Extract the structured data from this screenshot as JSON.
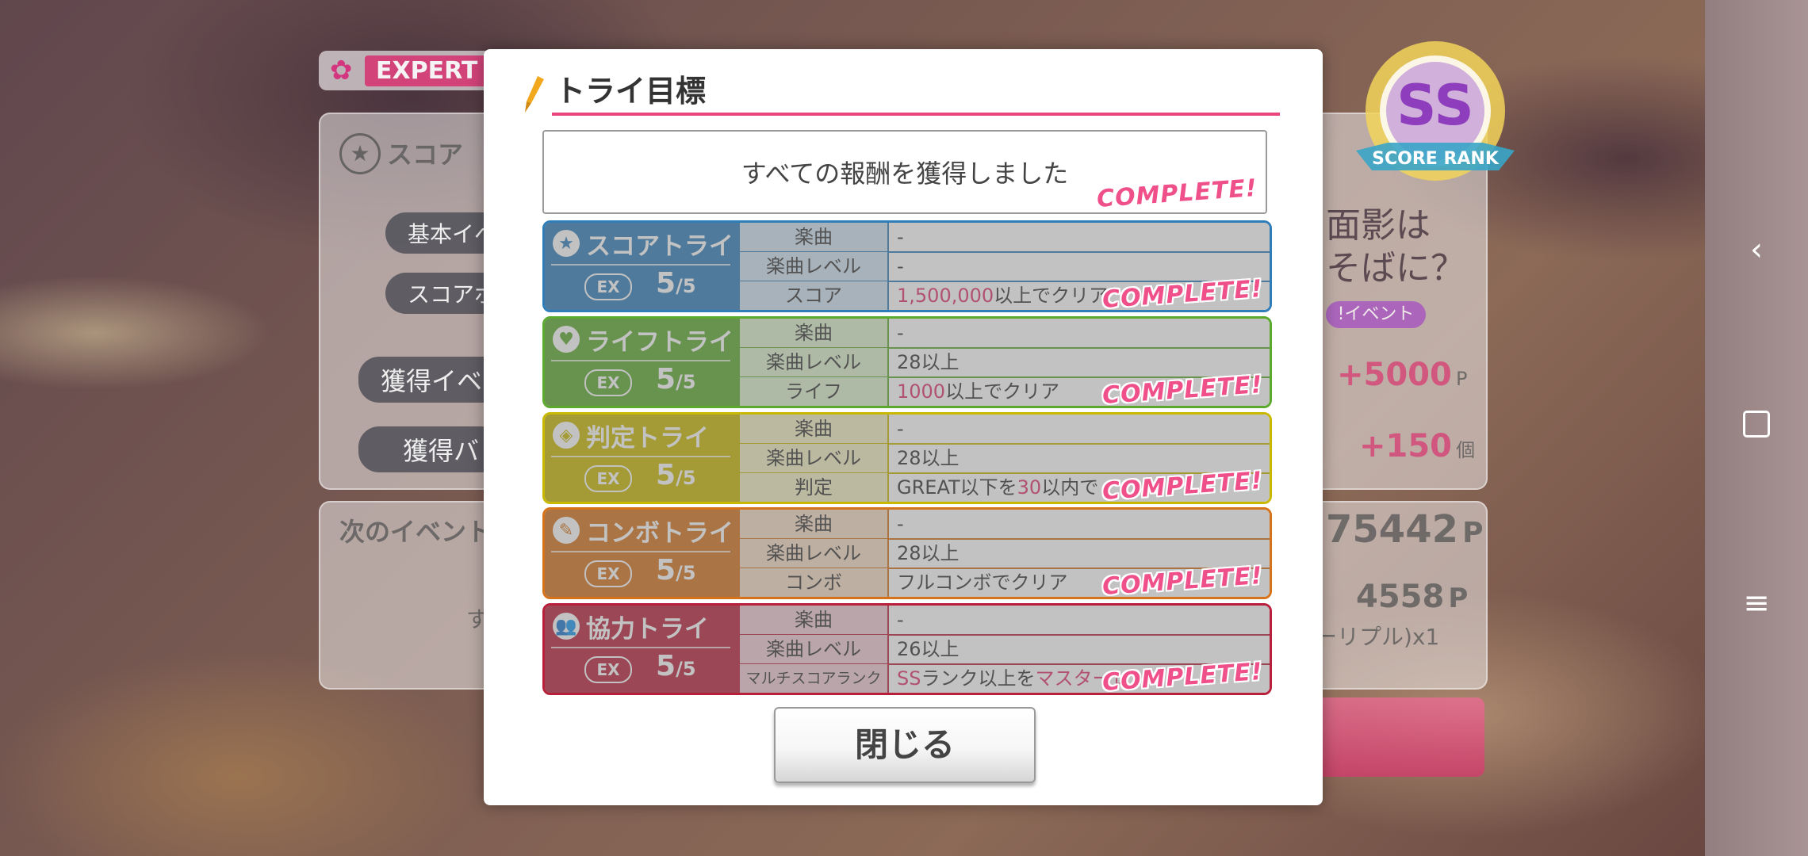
{
  "background": {
    "difficulty_label": "EXPERT",
    "score_label": "スコア",
    "base_event_label": "基本イベ",
    "score_bonus_label": "スコアボ",
    "earned_event_label": "獲得イベ",
    "earned_badge_label": "獲得バ",
    "points_value": "+5000",
    "points_unit": "P",
    "items_value": "+150",
    "items_unit": "個",
    "next_event_label": "次のイベント",
    "next_points": "75442",
    "next_points_unit": "P",
    "current_points": "4558",
    "current_points_unit": "P",
    "multiplier_text": "ーリプル)x1",
    "small_text": "す",
    "song_title": "面影は\nそばに？",
    "event_tag": "!イベント",
    "rank_label": "SS",
    "rank_caption": "SCORE RANK"
  },
  "modal": {
    "title": "トライ目標",
    "status": "すべての報酬を獲得しました",
    "complete_label": "COMPLETE!",
    "close_label": "閉じる",
    "tries": [
      {
        "name": "スコアトライ",
        "color": "#2e7db8",
        "light": "#cfe2f1",
        "icon": "★",
        "ex": "EX",
        "count": "5",
        "total": "/5",
        "rows": [
          {
            "label": "楽曲",
            "pre": "-",
            "hl": "",
            "post": ""
          },
          {
            "label": "楽曲レベル",
            "pre": "-",
            "hl": "",
            "post": ""
          },
          {
            "label": "スコア",
            "pre": "",
            "hl": "1,500,000",
            "post": "以上でクリア"
          }
        ]
      },
      {
        "name": "ライフトライ",
        "color": "#5ba92d",
        "light": "#dbefcd",
        "icon": "♥",
        "ex": "EX",
        "count": "5",
        "total": "/5",
        "rows": [
          {
            "label": "楽曲",
            "pre": "-",
            "hl": "",
            "post": ""
          },
          {
            "label": "楽曲レベル",
            "pre": "28以上",
            "hl": "",
            "post": ""
          },
          {
            "label": "ライフ",
            "pre": "",
            "hl": "1000",
            "post": "以上でクリア"
          }
        ]
      },
      {
        "name": "判定トライ",
        "color": "#c9b800",
        "light": "#f2eec0",
        "icon": "◈",
        "ex": "EX",
        "count": "5",
        "total": "/5",
        "rows": [
          {
            "label": "楽曲",
            "pre": "-",
            "hl": "",
            "post": ""
          },
          {
            "label": "楽曲レベル",
            "pre": "28以上",
            "hl": "",
            "post": ""
          },
          {
            "label": "判定",
            "pre": "GREAT以下を",
            "hl": "30",
            "post": "以内で"
          }
        ]
      },
      {
        "name": "コンボトライ",
        "color": "#d6721a",
        "light": "#f6dcc4",
        "icon": "✎",
        "ex": "EX",
        "count": "5",
        "total": "/5",
        "rows": [
          {
            "label": "楽曲",
            "pre": "-",
            "hl": "",
            "post": ""
          },
          {
            "label": "楽曲レベル",
            "pre": "28以上",
            "hl": "",
            "post": ""
          },
          {
            "label": "コンボ",
            "pre": "フルコンボでクリア",
            "hl": "",
            "post": ""
          }
        ]
      },
      {
        "name": "協力トライ",
        "color": "#b81f3a",
        "light": "#f0cdd3",
        "icon": "👥",
        "ex": "EX",
        "count": "5",
        "total": "/5",
        "rows": [
          {
            "label": "楽曲",
            "pre": "-",
            "hl": "",
            "post": ""
          },
          {
            "label": "楽曲レベル",
            "pre": "26以上",
            "hl": "",
            "post": ""
          },
          {
            "label": "マルチスコアランク",
            "pre": "",
            "hl": "SS",
            "post": "ランク以上を",
            "hl2": "マスターレ"
          }
        ]
      }
    ]
  },
  "navbar": {
    "back_icon": "chevron-left-icon",
    "home_icon": "square-icon",
    "menu_icon": "menu-icon"
  }
}
